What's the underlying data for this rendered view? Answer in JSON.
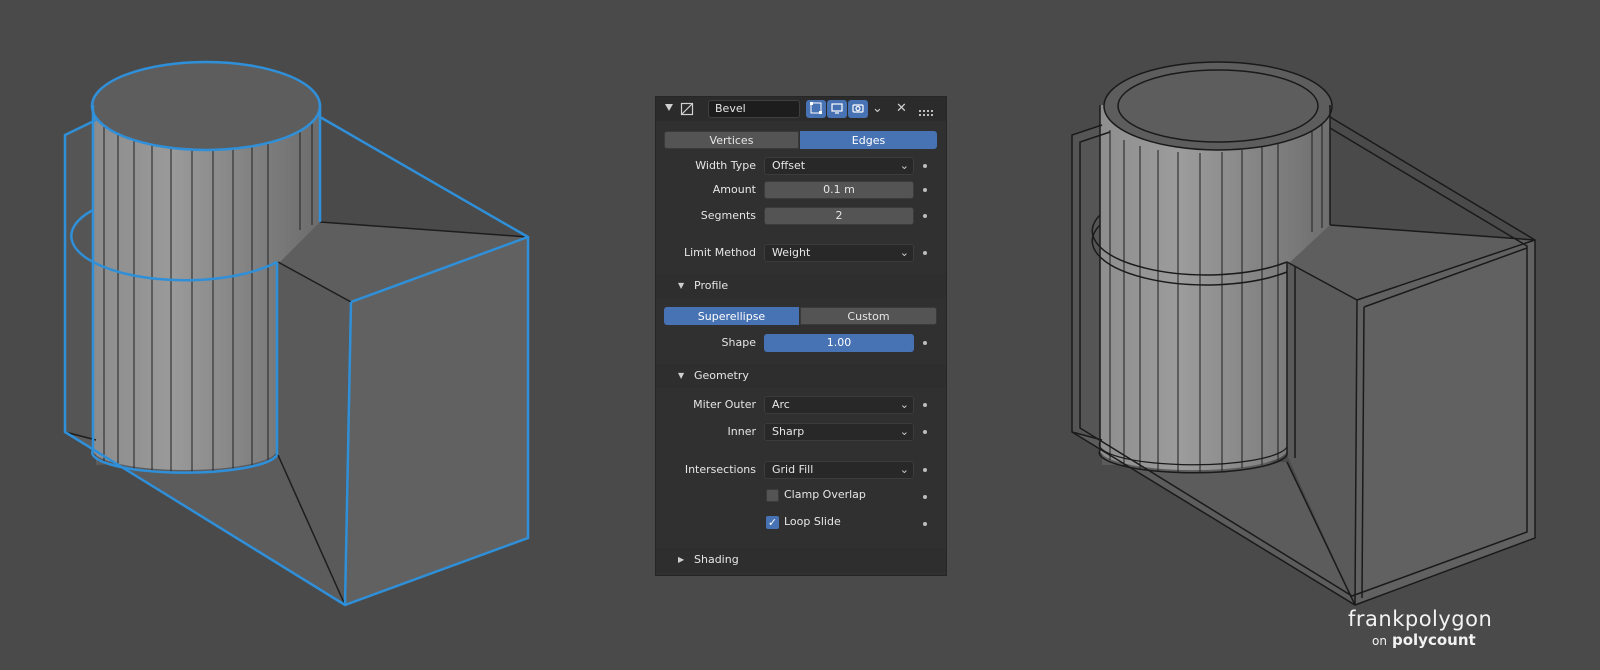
{
  "modifier": {
    "name": "Bevel",
    "mode_tabs": [
      "Vertices",
      "Edges"
    ],
    "active_mode": "Edges",
    "fields": {
      "width_type": {
        "label": "Width Type",
        "value": "Offset"
      },
      "amount": {
        "label": "Amount",
        "value": "0.1 m"
      },
      "segments": {
        "label": "Segments",
        "value": "2"
      },
      "limit_method": {
        "label": "Limit Method",
        "value": "Weight"
      }
    },
    "profile": {
      "title": "Profile",
      "tabs": [
        "Superellipse",
        "Custom"
      ],
      "active": "Superellipse",
      "shape": {
        "label": "Shape",
        "value": "1.00"
      }
    },
    "geometry": {
      "title": "Geometry",
      "miter_outer": {
        "label": "Miter Outer",
        "value": "Arc"
      },
      "inner": {
        "label": "Inner",
        "value": "Sharp"
      },
      "intersections": {
        "label": "Intersections",
        "value": "Grid Fill"
      },
      "clamp_overlap": {
        "label": "Clamp Overlap",
        "checked": false
      },
      "loop_slide": {
        "label": "Loop Slide",
        "checked": true
      }
    },
    "shading": {
      "title": "Shading"
    }
  },
  "watermark": {
    "author": "frankpolygon",
    "on": "on",
    "site": "polycount"
  },
  "colors": {
    "background": "#4a4a4a",
    "panel": "#303030",
    "accent": "#4772b3",
    "selected_edge": "#2f8fd8"
  },
  "icons": [
    "expand-triangle-icon",
    "wrench-icon",
    "edit-mode-icon",
    "realtime-icon",
    "render-icon",
    "chevron-down-icon",
    "close-icon",
    "drag-handle-icon"
  ]
}
